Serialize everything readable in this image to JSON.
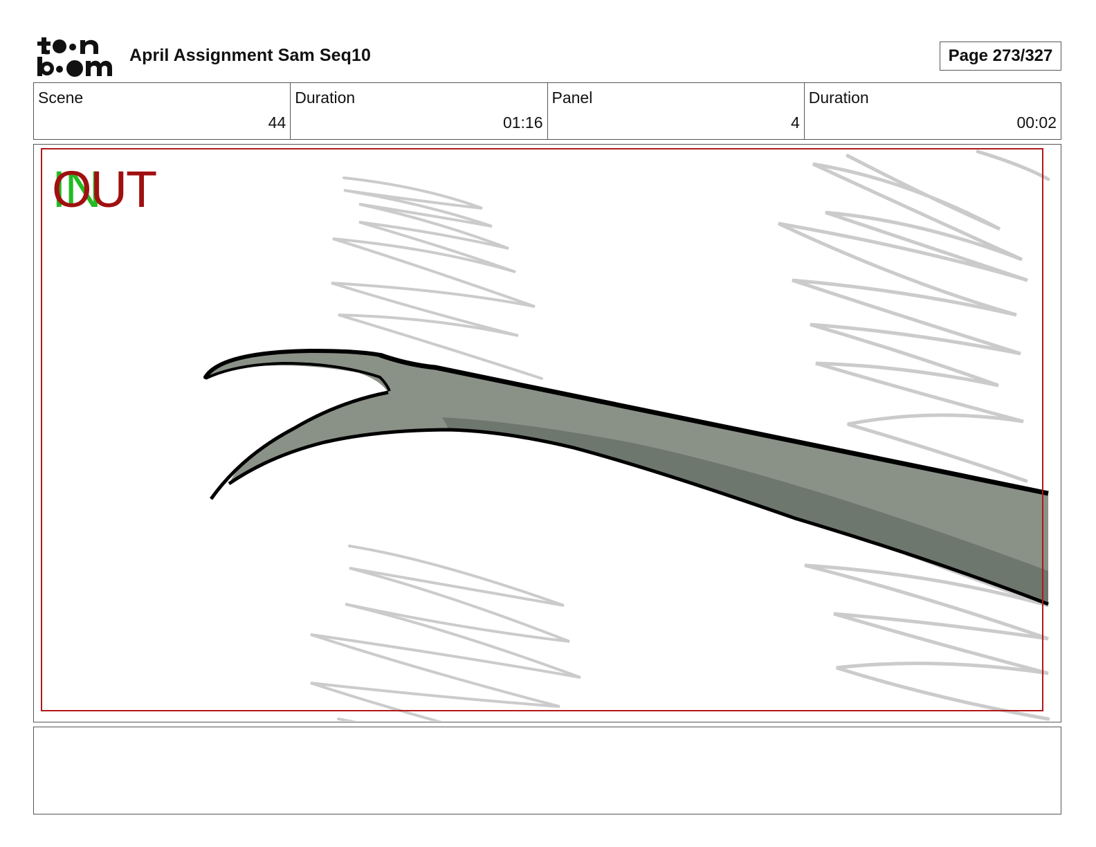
{
  "header": {
    "logo_text": "toonboom",
    "title": "April Assignment Sam Seq10",
    "page_label": "Page 273/327"
  },
  "info": {
    "scene_label": "Scene",
    "scene_value": "44",
    "scene_duration_label": "Duration",
    "scene_duration_value": "01:16",
    "panel_label": "Panel",
    "panel_value": "4",
    "panel_duration_label": "Duration",
    "panel_duration_value": "00:02"
  },
  "panel": {
    "in_marker": "IN",
    "out_marker": "OUT",
    "safe_frame_color": "#b01818",
    "branch_fill": "#8a9288",
    "branch_shadow": "#6e776e",
    "sketch_color": "#c8c8c8"
  },
  "notes": {
    "text": ""
  }
}
